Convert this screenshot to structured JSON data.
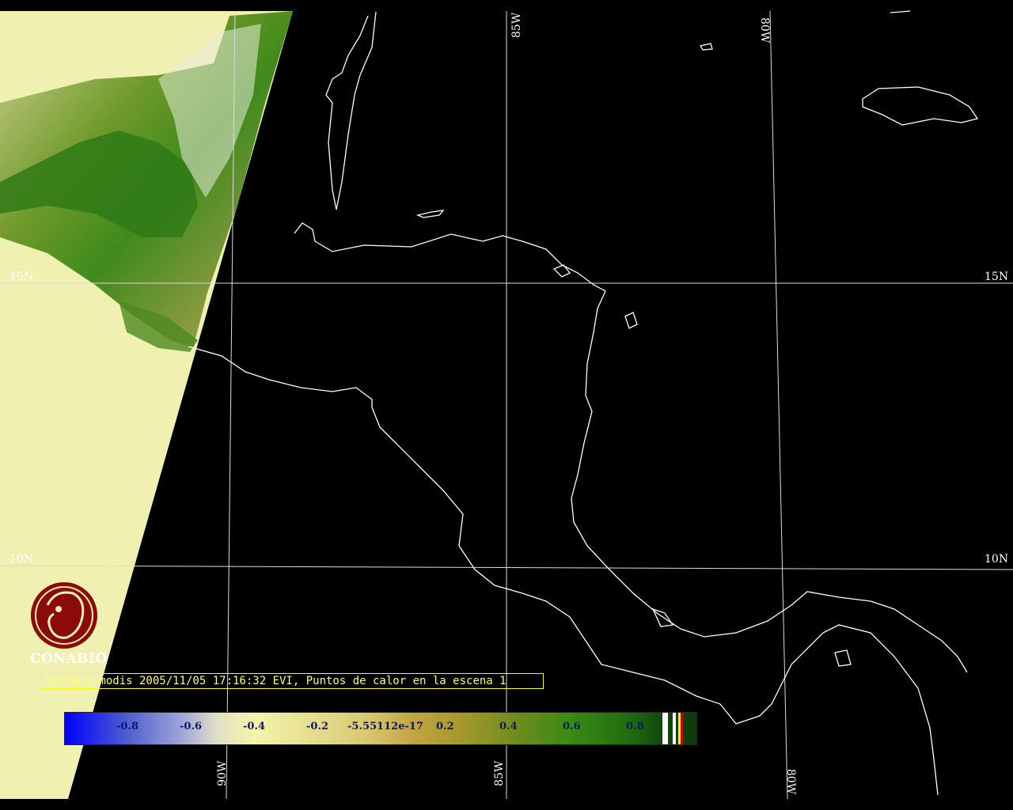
{
  "logo": {
    "text": "CONABIO",
    "color": "#8b0a0a"
  },
  "caption": {
    "text": "terra-1 modis 2005/11/05 17:16:32 EVI, Puntos de calor en la escena 1"
  },
  "grid_labels": {
    "lat_15_left": "15N",
    "lat_15_right": "15N",
    "lat_10_left": "10N",
    "lat_10_right": "10N",
    "lon_85_top": "85W",
    "lon_80_top": "80W",
    "lon_90_bottom": "90W",
    "lon_85_bottom": "85W",
    "lon_80_bottom": "80W"
  },
  "colorbar": {
    "ticks": [
      "-0.8",
      "-0.6",
      "-0.4",
      "-0.2",
      "-5.55112e-17",
      "0.2",
      "0.4",
      "0.6",
      "0.8"
    ],
    "range": [
      -1,
      1
    ]
  },
  "colors": {
    "background": "#000000",
    "land_swath": "#f0f0b0",
    "grid": "#dddddd",
    "coastline": "#ffffff",
    "caption_border": "#ffff00"
  }
}
